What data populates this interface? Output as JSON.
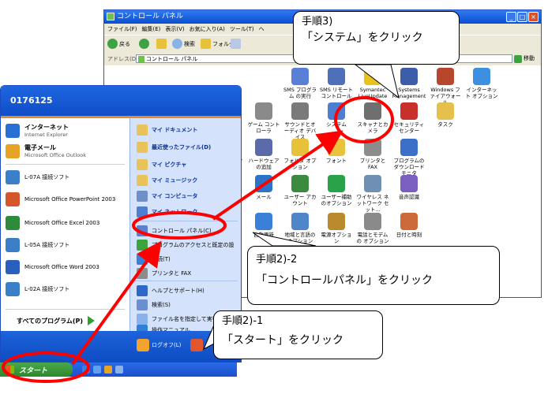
{
  "cp_window": {
    "title": "コントロール パネル",
    "menu": [
      "ファイル(F)",
      "編集(E)",
      "表示(V)",
      "お気に入り(A)",
      "ツール(T)",
      "ヘ"
    ],
    "toolbar": {
      "back": "戻る",
      "search": "検索",
      "folders": "フォルダ"
    },
    "address_label": "アドレス(D)",
    "address_value": "コントロール パネル",
    "go_label": "移動",
    "items": [
      {
        "label": "SMS プログラム の実行",
        "color": "#5a7fd6"
      },
      {
        "label": "SMS リモート コントロール",
        "color": "#4f6fb9"
      },
      {
        "label": "Symantec LiveUpdate",
        "color": "#e9c31b"
      },
      {
        "label": "Systems Management",
        "color": "#3c5ea8"
      },
      {
        "label": "Windows ファイアウォール",
        "color": "#b6472d"
      },
      {
        "label": "インターネット オプション",
        "color": "#3d8fe0"
      },
      {
        "label": "ゲーム コントローラ",
        "color": "#8a8a8a"
      },
      {
        "label": "サウンドとオーディオ デバイス",
        "color": "#7a7a7a"
      },
      {
        "label": "システム",
        "color": "#4d7ecf"
      },
      {
        "label": "スキャナとカメラ",
        "color": "#6f6f6f"
      },
      {
        "label": "セキュリティ センター",
        "color": "#c8302c"
      },
      {
        "label": "タスク",
        "color": "#e5c04d"
      },
      {
        "label": "ネットワーク接続",
        "color": "#3ea143"
      },
      {
        "label": "ハードウェアの追加",
        "color": "#5b6aa9"
      },
      {
        "label": "フォルダ オプション",
        "color": "#e8c13a"
      },
      {
        "label": "フォント",
        "color": "#e9c33c"
      },
      {
        "label": "プリンタと FAX",
        "color": "#8c8c8c"
      },
      {
        "label": "プログラムのダウンロード モニタ",
        "color": "#3b6fc8"
      },
      {
        "label": "マウス",
        "color": "#9a9a9a"
      },
      {
        "label": "メール",
        "color": "#2c74c8"
      },
      {
        "label": "ユーザー アカウント",
        "color": "#3a8a3f"
      },
      {
        "label": "ユーザー補助のオプション",
        "color": "#2aa24a"
      },
      {
        "label": "ワイヤレス ネットワーク セット...",
        "color": "#6f8fb5"
      },
      {
        "label": "音声認識",
        "color": "#7a5fc0"
      },
      {
        "label": "管理ツール",
        "color": "#6b6b6b"
      },
      {
        "label": "自動更新",
        "color": "#3a7fd8"
      },
      {
        "label": "地域と言語の オプション",
        "color": "#4e86c9"
      },
      {
        "label": "電源オプション",
        "color": "#b88a2d"
      },
      {
        "label": "電話とモデムの オプション",
        "color": "#8a8a8a"
      },
      {
        "label": "日付と時刻",
        "color": "#cc6a3a"
      }
    ],
    "partial_labels": [
      "ード",
      "とレ",
      "ーと",
      "設定"
    ]
  },
  "start_menu": {
    "user": "0176125",
    "left_items": [
      {
        "t1": "インターネット",
        "t2": "Internet Explorer",
        "color": "#2a6fd6"
      },
      {
        "t1": "電子メール",
        "t2": "Microsoft Office Outlook",
        "color": "#e7a326"
      },
      {
        "t": "L-07A 接続ソフト",
        "color": "#3a7fc8"
      },
      {
        "t": "Microsoft Office PowerPoint 2003",
        "color": "#d4562a"
      },
      {
        "t": "Microsoft Office Excel 2003",
        "color": "#2e8b3b"
      },
      {
        "t": "L-05A 接続ソフト",
        "color": "#3a7fc8"
      },
      {
        "t": "Microsoft Office Word 2003",
        "color": "#2b5fbf"
      },
      {
        "t": "L-02A 接続ソフト",
        "color": "#3a7fc8"
      }
    ],
    "all_programs": "すべてのプログラム(P)",
    "right_items": [
      {
        "t": "マイ ドキュメント",
        "bold": true,
        "color": "#e8c35a"
      },
      {
        "t": "最近使ったファイル(D)",
        "bold": true,
        "color": "#e8c35a",
        "submenu": true
      },
      {
        "t": "マイ ピクチャ",
        "bold": true,
        "color": "#e8c35a"
      },
      {
        "t": "マイ ミュージック",
        "bold": true,
        "color": "#e8c35a"
      },
      {
        "t": "マイ コンピュータ",
        "bold": true,
        "color": "#6e8fc8"
      },
      {
        "t": "マイ ネットワーク",
        "bold": true,
        "color": "#4d7ecf"
      },
      {
        "t": "コントロール パネル(C)",
        "bold": false,
        "color": "#5b7fcf"
      },
      {
        "t": "プログラムのアクセスと既定の設",
        "bold": false,
        "color": "#3aa53d"
      },
      {
        "t": "接続(T)",
        "bold": false,
        "color": "#3a7fd8",
        "submenu": true
      },
      {
        "t": "プリンタと FAX",
        "bold": false,
        "color": "#8c8c8c"
      },
      {
        "t": "ヘルプとサポート(H)",
        "bold": false,
        "color": "#2e67c8"
      },
      {
        "t": "検索(S)",
        "bold": false,
        "color": "#6a8fd0"
      },
      {
        "t": "ファイル名を指定して実行(R)...",
        "bold": false,
        "color": "#8ab2e8"
      },
      {
        "t": "操作マニュアル",
        "bold": false,
        "color": "#2f7fd8"
      }
    ],
    "logoff": "ログオフ(L)"
  },
  "taskbar": {
    "start_label": "スタート"
  },
  "callouts": {
    "step3": {
      "line1": "手順3)",
      "line2": "「システム」をクリック"
    },
    "step2_2": {
      "line1": "手順2)-2",
      "line2": "「コントロールパネル」をクリック"
    },
    "step2_1": {
      "line1": "手順2)-1",
      "line2": "「スタート」をクリック"
    }
  },
  "colors": {
    "highlight": "#ff0000",
    "xp_blue": "#0a4fd0",
    "start_green": "#2c8a2c"
  }
}
